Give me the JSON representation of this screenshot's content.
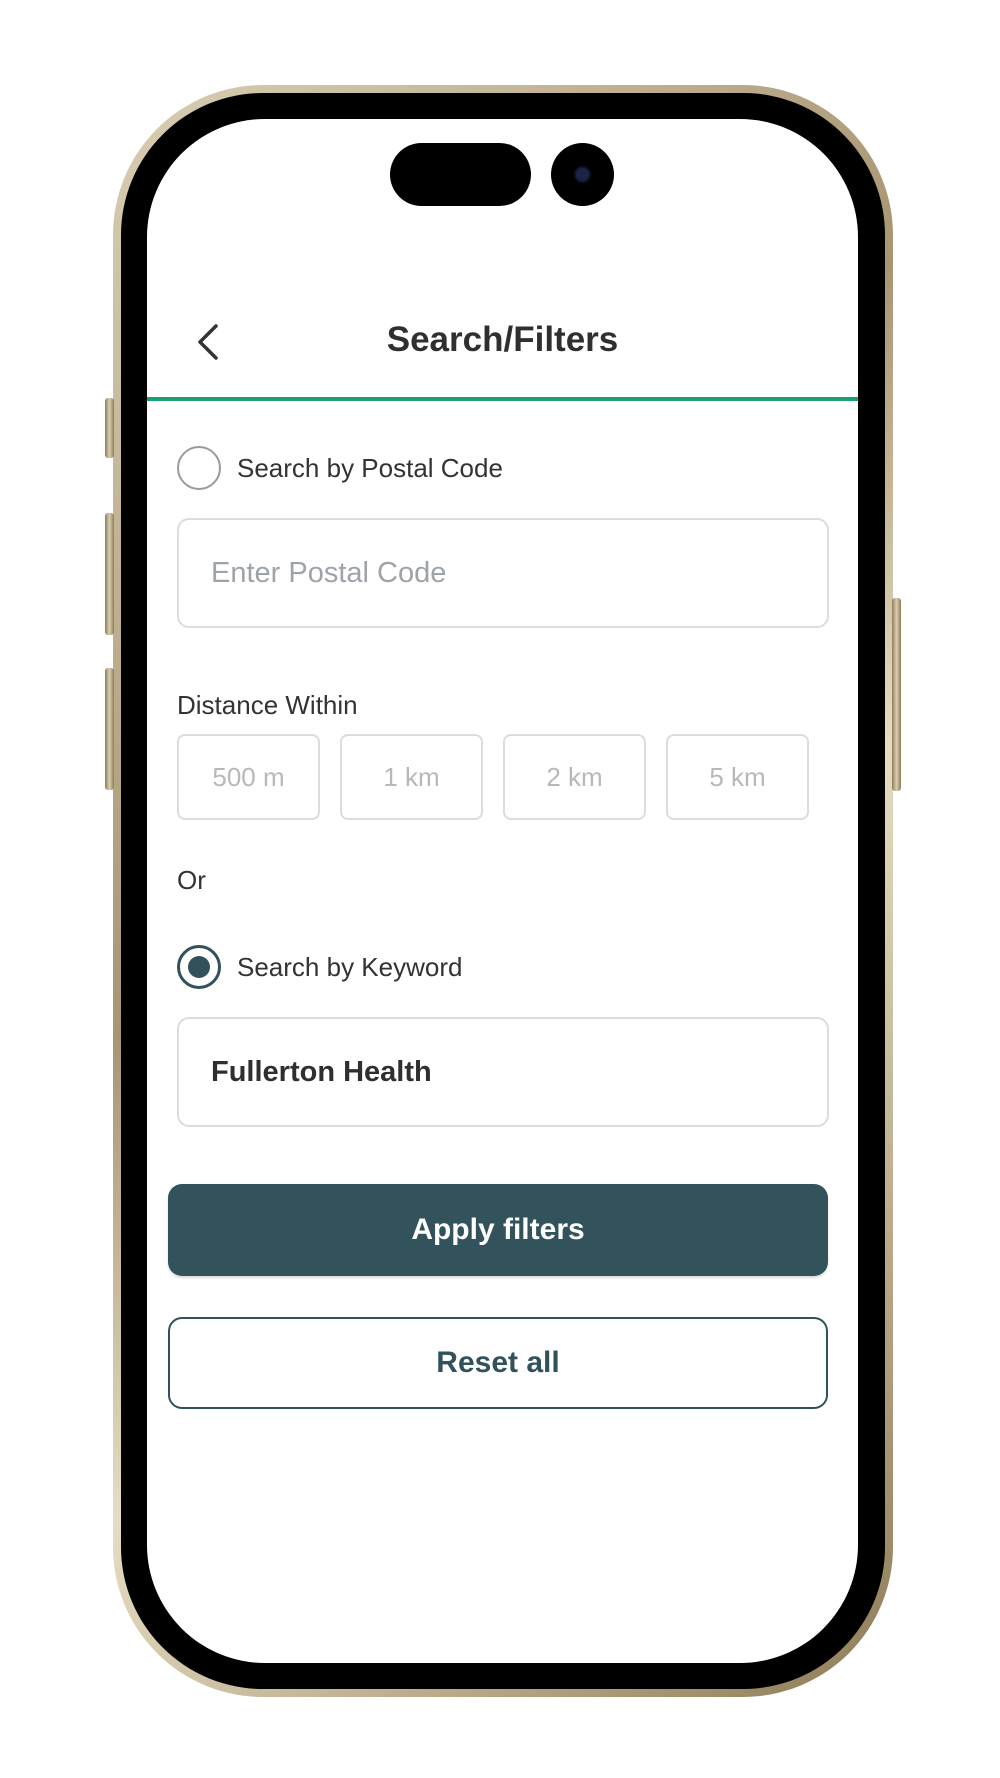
{
  "header": {
    "title": "Search/Filters",
    "back_icon": "chevron-left-icon"
  },
  "postal_search": {
    "radio_label": "Search by Postal Code",
    "selected": false,
    "input_value": "",
    "input_placeholder": "Enter Postal Code"
  },
  "distance": {
    "label": "Distance Within",
    "options": [
      "500 m",
      "1 km",
      "2 km",
      "5 km"
    ]
  },
  "separator_text": "Or",
  "keyword_search": {
    "radio_label": "Search by Keyword",
    "selected": true,
    "input_value": "Fullerton Health"
  },
  "actions": {
    "apply_label": "Apply filters",
    "reset_label": "Reset all"
  },
  "colors": {
    "accent_green": "#1aa078",
    "primary_teal": "#32525c"
  }
}
